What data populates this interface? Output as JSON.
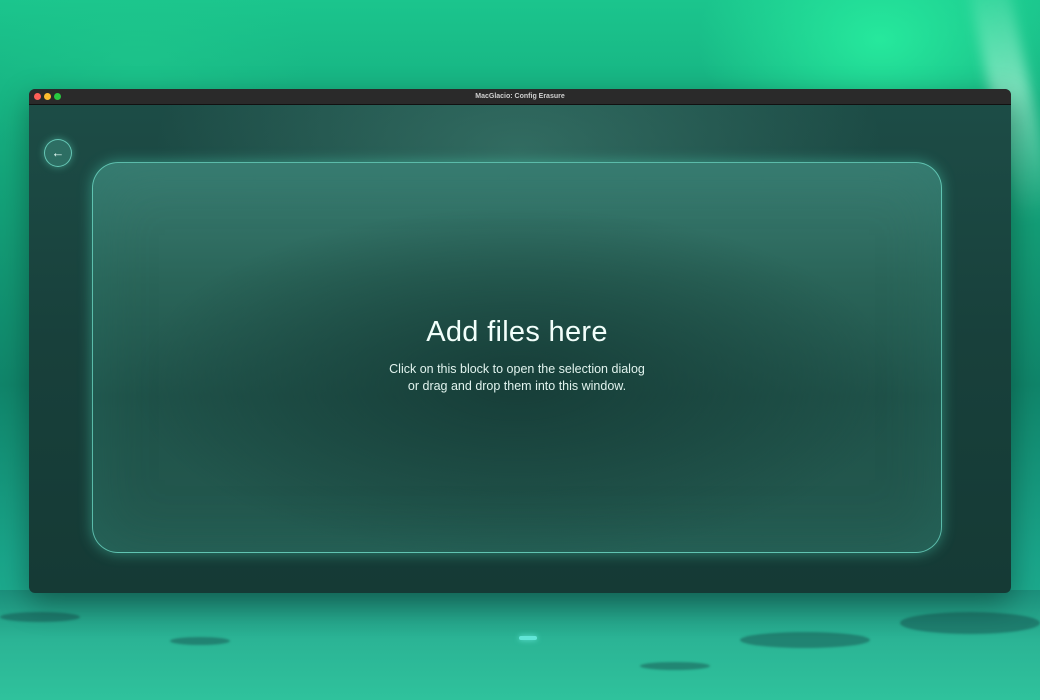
{
  "window": {
    "title": "MacGlacio: Config Erasure"
  },
  "toolbar": {
    "back_icon": "←"
  },
  "dropzone": {
    "title": "Add files here",
    "line1": "Click on this block to open the selection dialog",
    "line2": "or drag and drop them into this window."
  },
  "colors": {
    "accent": "#62e6d8",
    "window_bg": "#18403b",
    "dropzone_border": "#6edcc8"
  },
  "icons": {
    "back": "arrow-left-icon"
  }
}
